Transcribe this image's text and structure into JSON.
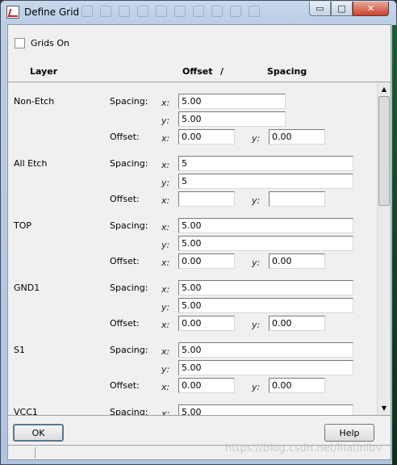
{
  "window": {
    "title": "Define Grid"
  },
  "titlebar_buttons": {
    "minimize": "▭",
    "maximize": "□",
    "close": "✕"
  },
  "grids_on": {
    "label": "Grids On",
    "checked": false
  },
  "headers": {
    "layer": "Layer",
    "offset": "Offset",
    "slash": "/",
    "spacing": "Spacing"
  },
  "labels": {
    "spacing": "Spacing:",
    "offset": "Offset:",
    "x": "x:",
    "y": "y:"
  },
  "layers": [
    {
      "name": "Non-Etch",
      "spacing_x": "5.00",
      "spacing_y": "5.00",
      "offset_x": "0.00",
      "offset_y": "0.00"
    },
    {
      "name": "All Etch",
      "spacing_x": "5",
      "spacing_y": "5",
      "offset_x": "",
      "offset_y": ""
    },
    {
      "name": "TOP",
      "spacing_x": "5.00",
      "spacing_y": "5.00",
      "offset_x": "0.00",
      "offset_y": "0.00"
    },
    {
      "name": "GND1",
      "spacing_x": "5.00",
      "spacing_y": "5.00",
      "offset_x": "0.00",
      "offset_y": "0.00"
    },
    {
      "name": "S1",
      "spacing_x": "5.00",
      "spacing_y": "5.00",
      "offset_x": "0.00",
      "offset_y": "0.00"
    },
    {
      "name": "VCC1",
      "spacing_x": "5.00"
    }
  ],
  "buttons": {
    "ok": "OK",
    "help": "Help"
  },
  "watermark": "https://blog.csdn.net/lliatinlbv",
  "colors": {
    "window_frame": "#b9cde5",
    "close_button": "#c7432e",
    "field_bg": "#ffffff"
  }
}
